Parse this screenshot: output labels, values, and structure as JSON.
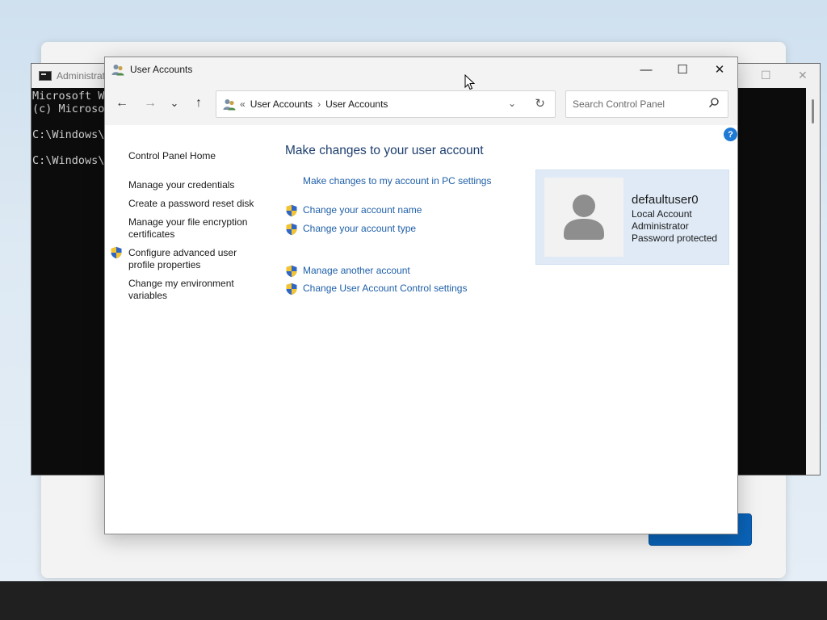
{
  "cmd": {
    "title": "Administrat",
    "lines": "Microsoft Wi\n(c) Microso\n\nC:\\Windows\\S\n\nC:\\Windows\\S"
  },
  "window": {
    "title": "User Accounts",
    "minimize": "—",
    "maximize": "☐",
    "close": "✕"
  },
  "nav": {
    "back": "←",
    "forward": "→",
    "recent": "⌄",
    "up": "↑",
    "breadcrumb_overflow": "«",
    "breadcrumb": [
      "User Accounts",
      "User Accounts"
    ],
    "search_placeholder": "Search Control Panel"
  },
  "left_nav": {
    "home": "Control Panel Home",
    "items": [
      "Manage your credentials",
      "Create a password reset disk",
      "Manage your file encryption certificates",
      "Configure advanced user profile properties",
      "Change my environment variables"
    ]
  },
  "main": {
    "heading": "Make changes to your user account",
    "pc_settings_link": "Make changes to my account in PC settings",
    "tasks_group1": [
      "Change your account name",
      "Change your account type"
    ],
    "tasks_group2": [
      "Manage another account",
      "Change User Account Control settings"
    ]
  },
  "user": {
    "name": "defaultuser0",
    "type": "Local Account",
    "role": "Administrator",
    "status": "Password protected"
  },
  "colors": {
    "accent": "#1e5fa8",
    "heading": "#1e3f6e",
    "card": "#dfeaf6",
    "help": "#1f7ad6"
  },
  "icons": [
    "users-icon",
    "shield-icon",
    "search-icon",
    "refresh-icon",
    "help-icon",
    "avatar-icon"
  ]
}
